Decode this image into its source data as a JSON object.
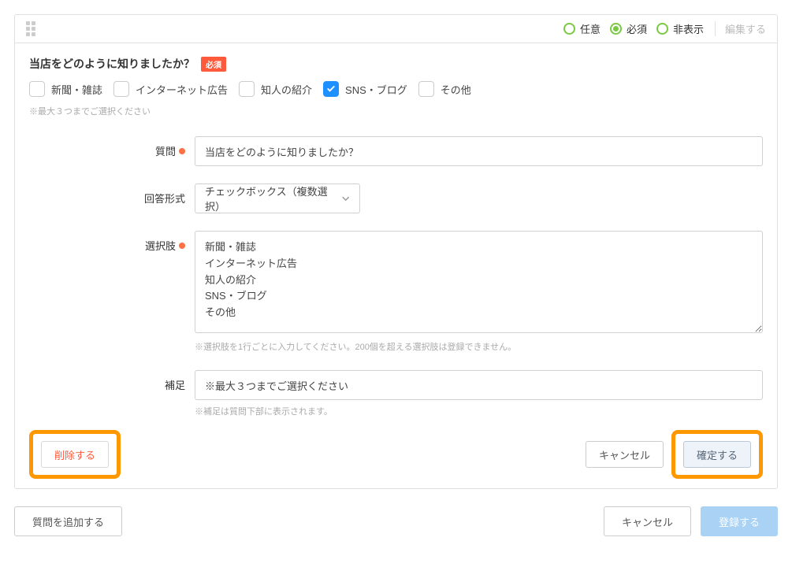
{
  "header": {
    "radios": {
      "optional": "任意",
      "required": "必須",
      "hidden": "非表示"
    },
    "edit_link": "編集する"
  },
  "preview": {
    "title": "当店をどのように知りましたか？",
    "badge": "必須",
    "options": [
      {
        "label": "新聞・雑誌",
        "checked": false
      },
      {
        "label": "インターネット広告",
        "checked": false
      },
      {
        "label": "知人の紹介",
        "checked": false
      },
      {
        "label": "SNS・ブログ",
        "checked": true
      },
      {
        "label": "その他",
        "checked": false
      }
    ],
    "hint": "※最大３つまでご選択ください"
  },
  "form": {
    "question_label": "質問",
    "question_value": "当店をどのように知りましたか？",
    "answer_label": "回答形式",
    "answer_value": "チェックボックス（複数選択）",
    "choices_label": "選択肢",
    "choices_value": "新聞・雑誌\nインターネット広告\n知人の紹介\nSNS・ブログ\nその他",
    "choices_help": "※選択肢を1行ごとに入力してください。200個を超える選択肢は登録できません。",
    "note_label": "補足",
    "note_value": "※最大３つまでご選択ください",
    "note_help": "※補足は質問下部に表示されます。"
  },
  "footer": {
    "delete": "削除する",
    "cancel": "キャンセル",
    "confirm": "確定する"
  },
  "bottom": {
    "add_question": "質問を追加する",
    "cancel": "キャンセル",
    "register": "登録する"
  }
}
